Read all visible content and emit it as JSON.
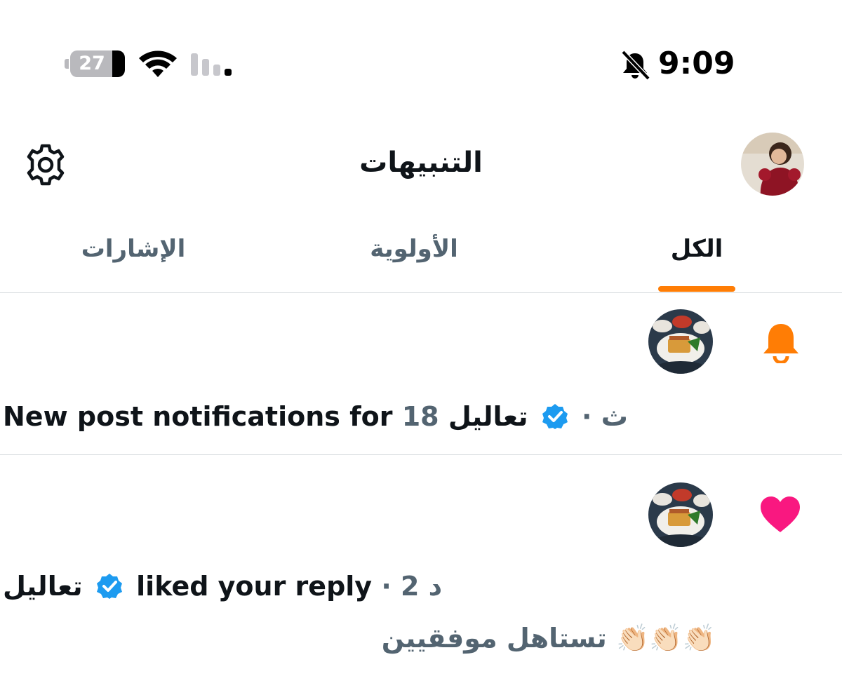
{
  "status_bar": {
    "battery_level": "27",
    "battery_fraction": 0.27,
    "time": "9:09",
    "icons": [
      "battery-icon",
      "wifi-icon",
      "cellular-signal-icon",
      "bell-muted-icon"
    ]
  },
  "header": {
    "title": "التنبيهات",
    "settings_icon": "gear-icon",
    "avatar": "profile-avatar"
  },
  "tabs": [
    {
      "label": "الكل",
      "selected": true
    },
    {
      "label": "الأولوية",
      "selected": false
    },
    {
      "label": "الإشارات",
      "selected": false
    }
  ],
  "notifications": [
    {
      "icon": "bell-icon",
      "account_name": "تعاليل",
      "verified": true,
      "separator": "·",
      "time": "18 ث",
      "text": "New post notifications for"
    },
    {
      "icon": "heart-icon",
      "account_name": "تعاليل",
      "verified": true,
      "separator": "·",
      "time": "2 د",
      "text": "liked your reply",
      "reply_text": "تستاهل موفقيين 👏🏻👏🏻👏🏻"
    }
  ],
  "colors": {
    "accent": "#ff7d05",
    "like": "#f91880",
    "verified": "#1d9bf0",
    "secondary_text": "#536471",
    "primary_text": "#0f1419"
  }
}
